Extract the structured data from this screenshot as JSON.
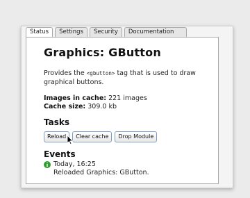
{
  "tabs": [
    {
      "label": "Status",
      "active": true
    },
    {
      "label": "Settings",
      "active": false
    },
    {
      "label": "Security",
      "active": false
    },
    {
      "label": "Documentation",
      "active": false
    }
  ],
  "main": {
    "title": "Graphics: GButton",
    "desc_prefix": "Provides the ",
    "desc_code": "<gbutton>",
    "desc_suffix": " tag that is used to draw graphical buttons.",
    "images_label": "Images in cache:",
    "images_value": "221 images",
    "size_label": "Cache size:",
    "size_value": "309.0 kb"
  },
  "tasks": {
    "heading": "Tasks",
    "reload": "Reload",
    "clear": "Clear cache",
    "drop": "Drop Module"
  },
  "events": {
    "heading": "Events",
    "items": [
      {
        "time": "Today, 16:25",
        "message": "Reloaded Graphics: GButton.",
        "icon": "info-icon",
        "color": "#2e9b2e"
      }
    ]
  }
}
